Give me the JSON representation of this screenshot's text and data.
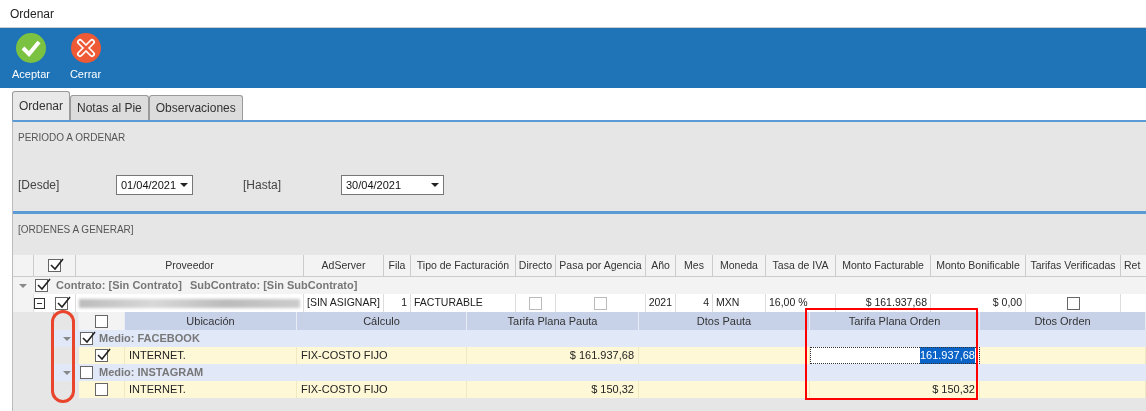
{
  "window": {
    "title": "Ordenar"
  },
  "toolbar": {
    "buttons": [
      {
        "label": "Aceptar",
        "kind": "accept"
      },
      {
        "label": "Cerrar",
        "kind": "close"
      }
    ]
  },
  "tabs": [
    {
      "label": "Ordenar",
      "selected": true
    },
    {
      "label": "Notas al Pie",
      "selected": false
    },
    {
      "label": "Observaciones",
      "selected": false
    }
  ],
  "period": {
    "title": "PERIODO A ORDENAR",
    "from": {
      "label": "[Desde]",
      "value": "01/04/2021"
    },
    "to": {
      "label": "[Hasta]",
      "value": "30/04/2021"
    }
  },
  "orders": {
    "title": "[ORDENES A GENERAR]",
    "header_checked": true,
    "columns": [
      "Proveedor",
      "AdServer",
      "Fila",
      "Tipo de Facturación",
      "Directo",
      "Pasa por Agencia",
      "Año",
      "Mes",
      "Moneda",
      "Tasa de IVA",
      "Monto Facturable",
      "Monto Bonificable",
      "Tarifas Verificadas",
      "Ret"
    ],
    "groups": [
      {
        "contrato": "Contrato: [Sin Contrato]",
        "subcontrato": "SubContrato: [Sin SubContrato]",
        "checked": true,
        "expanded": true,
        "rows": [
          {
            "checked": true,
            "expanded": true,
            "provider_blurred": true,
            "adserver": "[SIN ASIGNAR]",
            "fila": "1",
            "tipo": "FACTURABLE",
            "directo": false,
            "pasa_por_agencia": false,
            "anio": "2021",
            "mes": "4",
            "moneda": "MXN",
            "tasa_iva": "16,00 %",
            "monto_facturable": "$ 161.937,68",
            "monto_bonificable": "$ 0,00",
            "tarifas_verificadas": false
          }
        ]
      }
    ]
  },
  "detail": {
    "header_checked": false,
    "columns": [
      "Ubicación",
      "Cálculo",
      "Tarifa Plana Pauta",
      "Dtos Pauta",
      "Tarifa Plana Orden",
      "Dtos Orden"
    ],
    "groups": [
      {
        "label": "Medio: FACEBOOK",
        "checked": true,
        "expanded": true,
        "rows": [
          {
            "checked": true,
            "ubicacion": "INTERNET.",
            "calculo": "FIX-COSTO FIJO",
            "tarifa_pauta": "$ 161.937,68",
            "tarifa_orden": "161.937,68",
            "editing": true
          }
        ]
      },
      {
        "label": "Medio: INSTAGRAM",
        "checked": false,
        "expanded": true,
        "rows": [
          {
            "checked": false,
            "ubicacion": "INTERNET.",
            "calculo": "FIX-COSTO FIJO",
            "tarifa_pauta": "$ 150,32",
            "tarifa_orden": "$ 150,32",
            "editing": false
          }
        ]
      }
    ]
  },
  "highlights": [
    {
      "kind": "box",
      "color": "#ff0000"
    },
    {
      "kind": "oval",
      "color": "#e8452c"
    }
  ]
}
